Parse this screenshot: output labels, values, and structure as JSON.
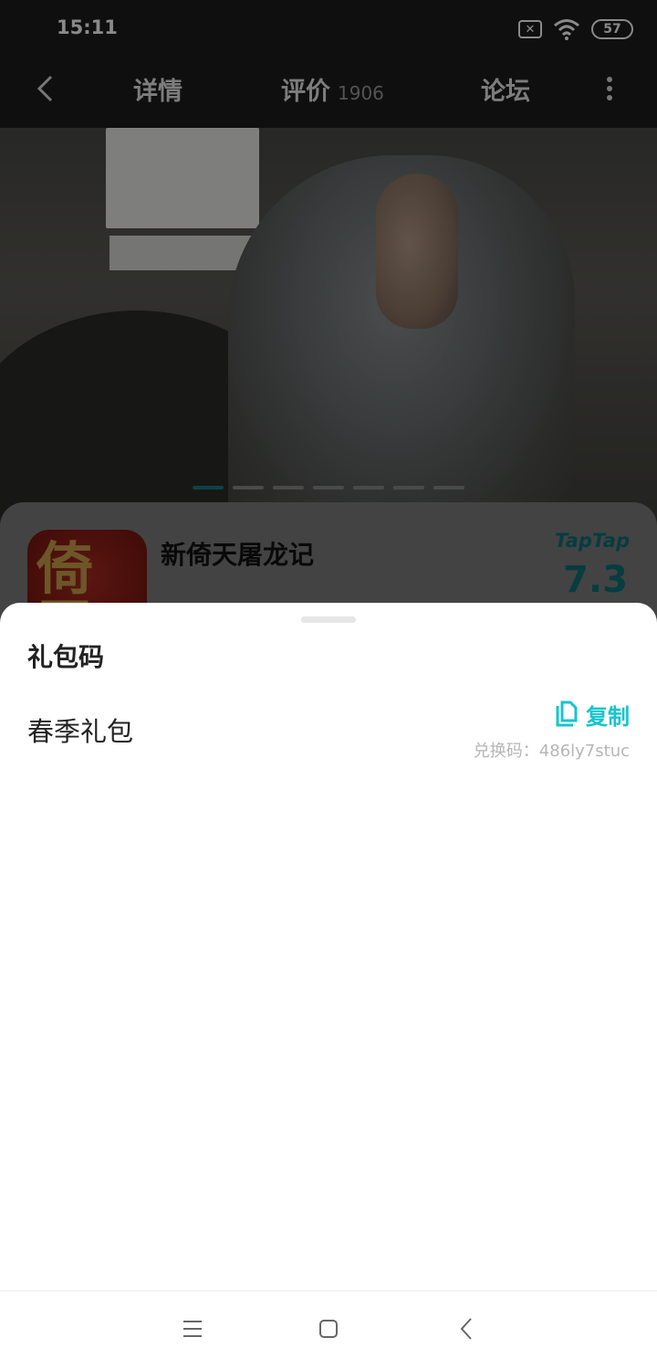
{
  "status_bar": {
    "time": "15:11",
    "sim_icon": "sim-off-icon",
    "wifi_icon": "wifi-icon",
    "battery": "57"
  },
  "nav": {
    "back_icon": "chevron-left-icon",
    "tabs": [
      {
        "label": "详情"
      },
      {
        "label": "评价",
        "count": "1906"
      },
      {
        "label": "论坛"
      }
    ],
    "more_icon": "more-vertical-icon"
  },
  "hero": {
    "slide_count": 7,
    "active_slide": 1,
    "accent_color": "#157d86"
  },
  "game": {
    "title": "新倚天屠龙记",
    "icon_glyph": "倚天",
    "rating_source": "TapTap",
    "rating": "7.3"
  },
  "sheet": {
    "title": "礼包码",
    "gift_name": "春季礼包",
    "copy_label": "复制",
    "copy_icon": "copy-icon",
    "code_label": "兑换码：",
    "code_value": "486ly7stuc",
    "accent_color": "#15c5ce"
  },
  "system_nav": {
    "menu_icon": "menu-icon",
    "home_icon": "home-icon",
    "back_icon": "back-icon"
  }
}
